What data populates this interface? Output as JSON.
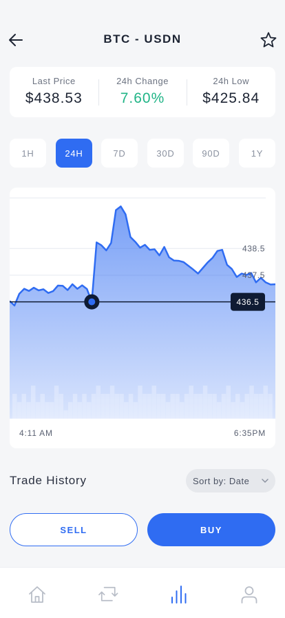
{
  "header": {
    "title": "BTC - USDN",
    "back_icon": "arrow-left-icon",
    "favorite_icon": "star-icon"
  },
  "stats": [
    {
      "label": "Last Price",
      "value": "$438.53",
      "accent": ""
    },
    {
      "label": "24h Change",
      "value": "7.60%",
      "accent": "#20b486"
    },
    {
      "label": "24h Low",
      "value": "$425.84",
      "accent": ""
    }
  ],
  "timeframes": {
    "options": [
      "1H",
      "24H",
      "7D",
      "30D",
      "90D",
      "1Y"
    ],
    "selected": "24H"
  },
  "colors": {
    "accent": "#2f6cf2",
    "positive": "#20b486",
    "tooltip_bg": "#0f1b33"
  },
  "chart_data": {
    "type": "area",
    "y_tick_labels": [
      "438.5",
      "437.5",
      "436.5"
    ],
    "y_ticks": [
      438.5,
      437.5,
      436.5
    ],
    "ylim": [
      434.55,
      440.24
    ],
    "x_labels": {
      "start": "4:11 AM",
      "end": "6:35PM"
    },
    "crosshair": {
      "index": 17,
      "value": 436.5,
      "label": "436.5"
    },
    "grid": true,
    "values": [
      436.53,
      436.36,
      436.8,
      436.99,
      436.91,
      437.03,
      436.93,
      436.97,
      436.83,
      436.9,
      437.11,
      437.1,
      436.94,
      437.16,
      436.99,
      437.12,
      436.98,
      436.5,
      438.73,
      438.62,
      438.43,
      438.71,
      439.94,
      440.08,
      439.78,
      438.93,
      438.75,
      438.53,
      438.64,
      438.45,
      438.47,
      438.24,
      438.56,
      438.17,
      438.05,
      438.04,
      437.99,
      437.85,
      437.71,
      437.56,
      437.77,
      437.98,
      438.15,
      438.41,
      438.45,
      437.89,
      437.73,
      437.43,
      437.56,
      437.51,
      437.58,
      437.23,
      437.4,
      437.23,
      437.15,
      437.16
    ],
    "volume": [
      3,
      2,
      3,
      2,
      4,
      2,
      3,
      2,
      2,
      4,
      3,
      1,
      2,
      3,
      2,
      3,
      2,
      3,
      4,
      3,
      3,
      4,
      3,
      3,
      2,
      3,
      2,
      4,
      3,
      3,
      4,
      3,
      3,
      2,
      3,
      3,
      2,
      3,
      4,
      3,
      3,
      4,
      3,
      3,
      2,
      3,
      4,
      2,
      3,
      2,
      3,
      4,
      3,
      3,
      4,
      3
    ]
  },
  "trade_history": {
    "title": "Trade History",
    "sort_label": "Sort by: Date"
  },
  "actions": {
    "sell": "SELL",
    "buy": "BUY"
  },
  "tabbar": {
    "icons": [
      "home-icon",
      "exchange-icon",
      "chart-icon",
      "profile-icon"
    ],
    "active": 2
  }
}
